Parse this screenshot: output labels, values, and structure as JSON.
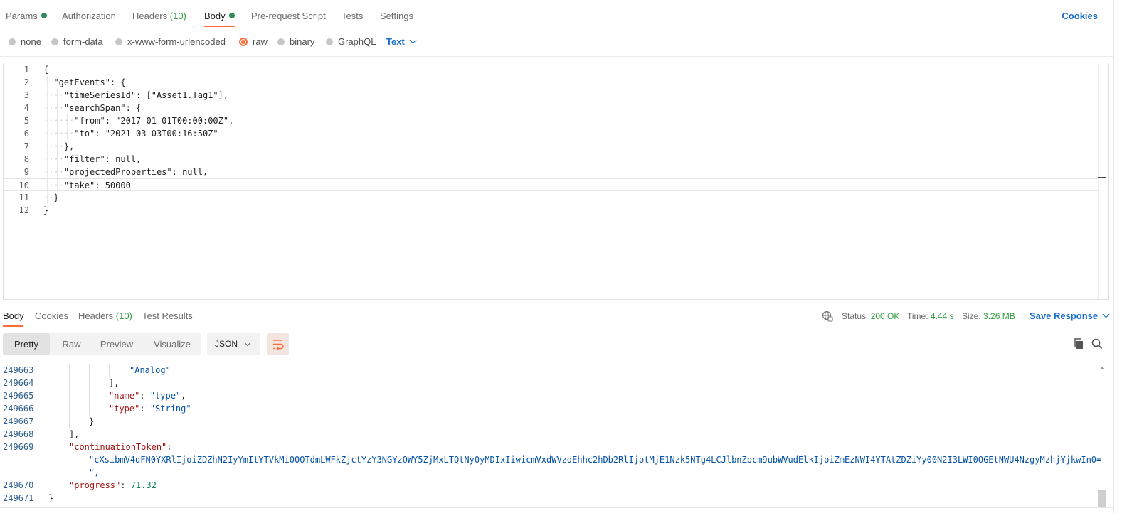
{
  "request_tabs": {
    "params": "Params",
    "authorization": "Authorization",
    "headers": "Headers",
    "headers_count": "(10)",
    "body": "Body",
    "pre_request_script": "Pre-request Script",
    "tests": "Tests",
    "settings": "Settings",
    "cookies": "Cookies"
  },
  "body_types": {
    "none": "none",
    "form_data": "form-data",
    "urlencoded": "x-www-form-urlencoded",
    "raw": "raw",
    "binary": "binary",
    "graphql": "GraphQL",
    "selected": "raw",
    "language": "Text"
  },
  "editor": {
    "current_line": 10,
    "lines": [
      {
        "n": "1",
        "indent": "",
        "text": "{"
      },
      {
        "n": "2",
        "indent": "··",
        "text": "\"getEvents\": {"
      },
      {
        "n": "3",
        "indent": "····",
        "text": "\"timeSeriesId\": [\"Asset1.Tag1\"],"
      },
      {
        "n": "4",
        "indent": "····",
        "text": "\"searchSpan\": {"
      },
      {
        "n": "5",
        "indent": "······",
        "text": "\"from\": \"2017-01-01T00:00:00Z\","
      },
      {
        "n": "6",
        "indent": "······",
        "text": "\"to\": \"2021-03-03T00:16:50Z\""
      },
      {
        "n": "7",
        "indent": "····",
        "text": "},"
      },
      {
        "n": "8",
        "indent": "····",
        "text": "\"filter\": null,"
      },
      {
        "n": "9",
        "indent": "····",
        "text": "\"projectedProperties\": null,"
      },
      {
        "n": "10",
        "indent": "····",
        "text": "\"take\": 50000"
      },
      {
        "n": "11",
        "indent": "··",
        "text": "}"
      },
      {
        "n": "12",
        "indent": "",
        "text": "}"
      }
    ]
  },
  "response_tabs": {
    "body": "Body",
    "cookies": "Cookies",
    "headers": "Headers",
    "headers_count": "(10)",
    "test_results": "Test Results"
  },
  "response_status": {
    "status_label": "Status:",
    "status_value": "200 OK",
    "time_label": "Time:",
    "time_value": "4.44 s",
    "size_label": "Size:",
    "size_value": "3.26 MB",
    "save_response": "Save Response"
  },
  "response_views": {
    "pretty": "Pretty",
    "raw": "Raw",
    "preview": "Preview",
    "visualize": "Visualize",
    "format": "JSON"
  },
  "response_body": {
    "lines": [
      {
        "n": "249663",
        "parts": [
          {
            "t": "\"Analog\"",
            "c": "str"
          }
        ]
      },
      {
        "n": "249664",
        "parts": [
          {
            "t": "],",
            "c": ""
          }
        ]
      },
      {
        "n": "249665",
        "parts": [
          {
            "t": "\"name\"",
            "c": "key"
          },
          {
            "t": ": ",
            "c": ""
          },
          {
            "t": "\"type\"",
            "c": "str"
          },
          {
            "t": ",",
            "c": ""
          }
        ]
      },
      {
        "n": "249666",
        "parts": [
          {
            "t": "\"type\"",
            "c": "key"
          },
          {
            "t": ": ",
            "c": ""
          },
          {
            "t": "\"String\"",
            "c": "str"
          }
        ]
      },
      {
        "n": "249667",
        "parts": [
          {
            "t": "}",
            "c": ""
          }
        ]
      },
      {
        "n": "249668",
        "parts": [
          {
            "t": "],",
            "c": ""
          }
        ]
      },
      {
        "n": "249669",
        "parts": [
          {
            "t": "\"continuationToken\"",
            "c": "key"
          },
          {
            "t": ":",
            "c": ""
          }
        ]
      },
      {
        "n": "",
        "parts": [
          {
            "t": "\"cXsibmV4dFN0YXRlIjoiZDZhN2IyYmItYTVkMi00OTdmLWFkZjctYzY3NGYzOWY5ZjMxLTQtNy0yMDIxIiwicmVxdWVzdEhhc2hDb2RlIjotMjE1Nzk5NTg4LCJlbnZpcm9ubWVudElkIjoiZmEzNWI4YTAtZDZiYy00N2I3LWI0OGEtNWU4NzgyMzhjYjkwIn0=",
            "c": "str"
          }
        ]
      },
      {
        "n": "",
        "parts": [
          {
            "t": "\",",
            "c": "str"
          }
        ]
      },
      {
        "n": "249670",
        "parts": [
          {
            "t": "\"progress\"",
            "c": "key"
          },
          {
            "t": ": ",
            "c": ""
          },
          {
            "t": "71.32",
            "c": "num"
          }
        ]
      },
      {
        "n": "249671",
        "parts": [
          {
            "t": "}",
            "c": ""
          }
        ]
      }
    ]
  }
}
